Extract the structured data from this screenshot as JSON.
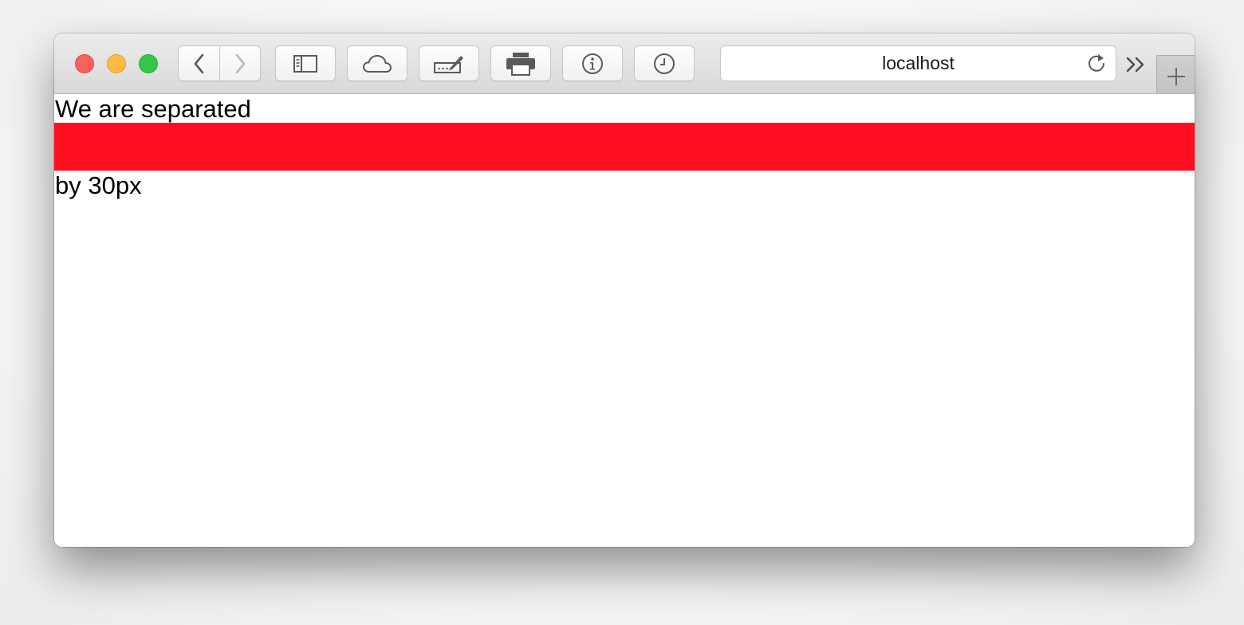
{
  "window": {
    "address": "localhost"
  },
  "toolbar": {
    "icons": {
      "back": "chevron-left-icon",
      "forward": "chevron-right-icon",
      "sidebar": "sidebar-icon",
      "cloud": "cloud-icon",
      "markup": "pen-signature-icon",
      "print": "printer-icon",
      "info": "info-icon",
      "history": "clock-icon",
      "reload": "reload-icon",
      "overflow": "double-chevron-icon",
      "new_tab": "plus-icon"
    }
  },
  "page": {
    "line1": "We are separated",
    "line2": "by 30px",
    "separator_color": "#fd0f1f"
  },
  "colors": {
    "close": "#fc605c",
    "minimize": "#fdbc40",
    "maximize": "#34c84a"
  }
}
